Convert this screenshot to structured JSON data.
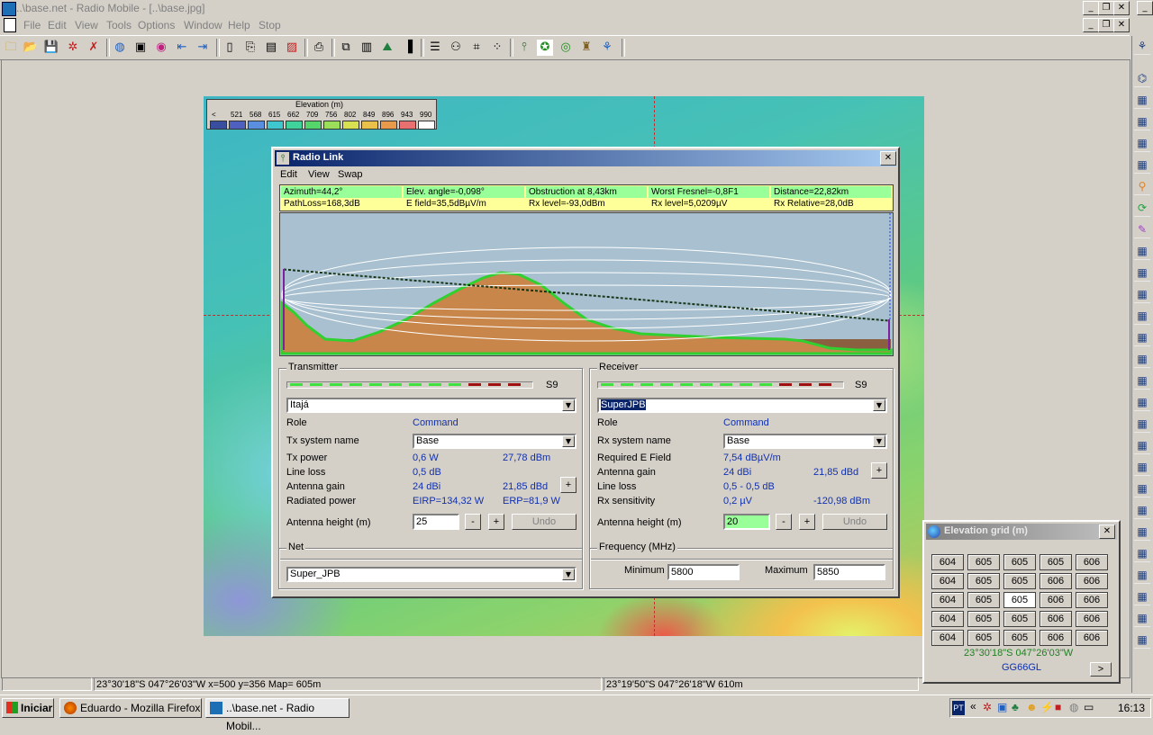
{
  "app": {
    "title": "..\\base.net - Radio Mobile - [..\\base.jpg]"
  },
  "menu": [
    "File",
    "Edit",
    "View",
    "Tools",
    "Options",
    "Window",
    "Help",
    "Stop"
  ],
  "legend": {
    "title": "Elevation (m)",
    "values": [
      "<",
      "521",
      "568",
      "615",
      "662",
      "709",
      "756",
      "802",
      "849",
      "896",
      "943",
      "990"
    ],
    "colors": [
      "#3a4ea0",
      "#4f60c0",
      "#5a8fe0",
      "#3fc7d0",
      "#3fd29a",
      "#55d66a",
      "#9ade5a",
      "#d7e050",
      "#e8c04a",
      "#e89a4a",
      "#e87070",
      "#ffffff"
    ]
  },
  "dialog": {
    "title": "Radio Link",
    "menu": [
      "Edit",
      "View",
      "Swap"
    ],
    "info": [
      [
        "Azimuth=44,2°",
        "Elev. angle=-0,098°",
        "Obstruction at 8,43km",
        "Worst Fresnel=-0,8F1",
        "Distance=22,82km"
      ],
      [
        "PathLoss=168,3dB",
        "E field=35,5dBµV/m",
        "Rx level=-93,0dBm",
        "Rx level=5,0209µV",
        "Rx Relative=28,0dB"
      ]
    ],
    "transmitter": {
      "group_label": "Transmitter",
      "s_unit": "S9",
      "station": "Itajá",
      "role_label": "Role",
      "role": "Command",
      "system_label": "Tx system name",
      "system": "Base",
      "power_label": "Tx power",
      "power_w": "0,6 W",
      "power_dbm": "27,78 dBm",
      "loss_label": "Line loss",
      "loss": "0,5 dB",
      "gain_label": "Antenna gain",
      "gain_dbi": "24 dBi",
      "gain_dbd": "21,85 dBd",
      "radiated_label": "Radiated power",
      "eirp": "EIRP=134,32 W",
      "erp": "ERP=81,9 W",
      "height_label": "Antenna height (m)",
      "height": "25"
    },
    "receiver": {
      "group_label": "Receiver",
      "s_unit": "S9",
      "station": "SuperJPB",
      "role_label": "Role",
      "role": "Command",
      "system_label": "Rx system name",
      "system": "Base",
      "field_label": "Required E Field",
      "field": "7,54 dBµV/m",
      "gain_label": "Antenna gain",
      "gain_dbi": "24 dBi",
      "gain_dbd": "21,85 dBd",
      "loss_label": "Line loss",
      "loss": "0,5 - 0,5 dB",
      "sens_label": "Rx sensitivity",
      "sens_uv": "0,2 µV",
      "sens_dbm": "-120,98 dBm",
      "height_label": "Antenna height (m)",
      "height": "20"
    },
    "net": {
      "group_label": "Net",
      "value": "Super_JPB"
    },
    "frequency": {
      "group_label": "Frequency (MHz)",
      "min_label": "Minimum",
      "min": "5800",
      "max_label": "Maximum",
      "max": "5850"
    },
    "buttons": {
      "plus": "+",
      "minus": "-",
      "undo": "Undo"
    }
  },
  "elev_grid": {
    "title": "Elevation grid (m)",
    "rows": [
      [
        "604",
        "605",
        "605",
        "605",
        "606"
      ],
      [
        "604",
        "605",
        "605",
        "606",
        "606"
      ],
      [
        "604",
        "605",
        "605",
        "606",
        "606"
      ],
      [
        "604",
        "605",
        "605",
        "606",
        "606"
      ],
      [
        "604",
        "605",
        "605",
        "606",
        "606"
      ]
    ],
    "coords": "23°30'18\"S  047°26'03\"W",
    "locator": "GG66GL",
    "next": ">"
  },
  "status": {
    "left": "23°30'18\"S  047°26'03\"W  x=500 y=356 Map= 605m",
    "right": "23°19'50\"S 047°26'18\"W 610m"
  },
  "taskbar": {
    "start": "Iniciar",
    "tasks": [
      "Eduardo - Mozilla Firefox",
      "..\\base.net - Radio Mobil..."
    ],
    "lang": "PT",
    "clock": "16:13"
  },
  "colors": {
    "title_active": "#0a246a",
    "signal_green": "#40e040",
    "signal_red": "#a01010",
    "profile_bg": "#a8c0d0",
    "terrain": "#c8864a",
    "highlight": "#99ff99"
  }
}
